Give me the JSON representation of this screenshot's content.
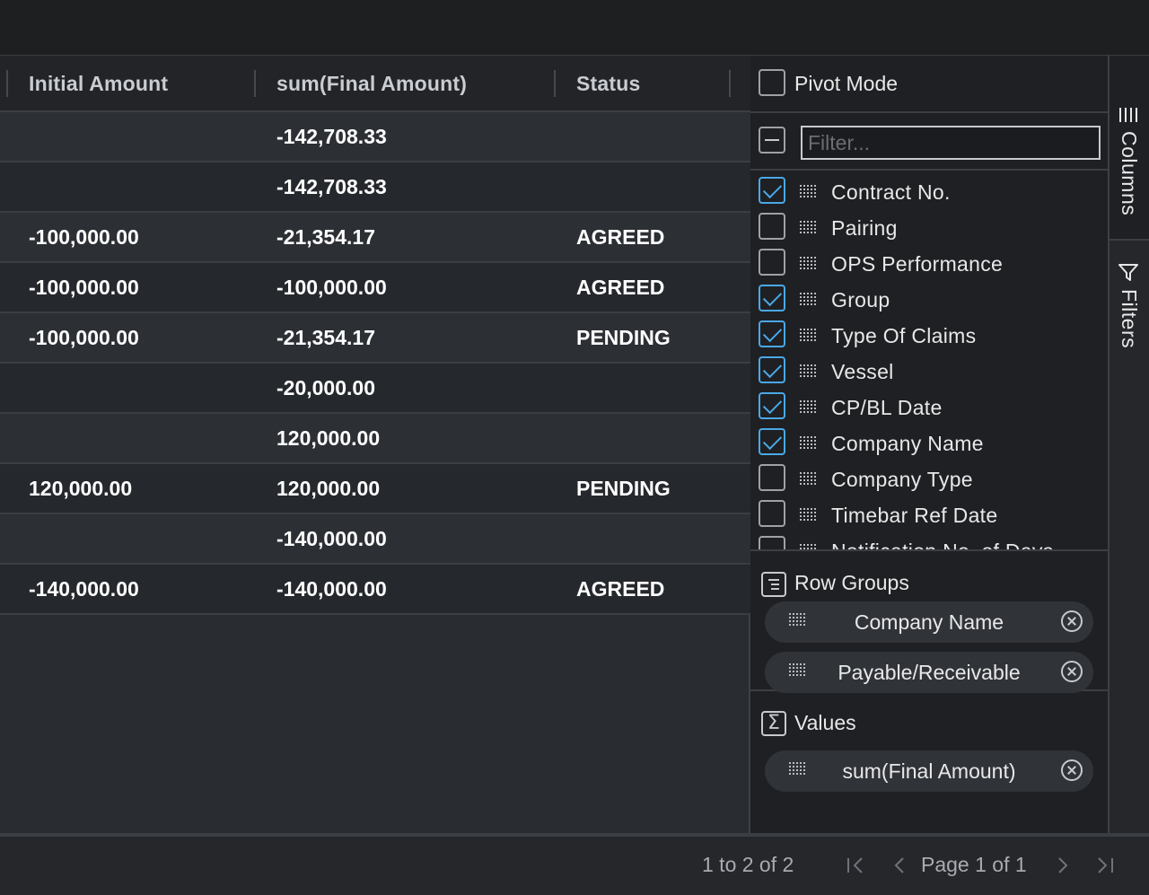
{
  "grid": {
    "columns": [
      "Initial Amount",
      "sum(Final Amount)",
      "Status"
    ],
    "rows": [
      [
        "",
        "-142,708.33",
        ""
      ],
      [
        "",
        "-142,708.33",
        ""
      ],
      [
        "-100,000.00",
        "-21,354.17",
        "AGREED"
      ],
      [
        "-100,000.00",
        "-100,000.00",
        "AGREED"
      ],
      [
        "-100,000.00",
        "-21,354.17",
        "PENDING"
      ],
      [
        "",
        "-20,000.00",
        ""
      ],
      [
        "",
        "120,000.00",
        ""
      ],
      [
        "120,000.00",
        "120,000.00",
        "PENDING"
      ],
      [
        "",
        "-140,000.00",
        ""
      ],
      [
        "-140,000.00",
        "-140,000.00",
        "AGREED"
      ]
    ]
  },
  "panel": {
    "pivot_mode_label": "Pivot Mode",
    "filter_placeholder": "Filter...",
    "columns": [
      {
        "label": "Contract No.",
        "checked": true
      },
      {
        "label": "Pairing",
        "checked": false
      },
      {
        "label": "OPS Performance",
        "checked": false
      },
      {
        "label": "Group",
        "checked": true
      },
      {
        "label": "Type Of Claims",
        "checked": true
      },
      {
        "label": "Vessel",
        "checked": true
      },
      {
        "label": "CP/BL Date",
        "checked": true
      },
      {
        "label": "Company Name",
        "checked": true
      },
      {
        "label": "Company Type",
        "checked": false
      },
      {
        "label": "Timebar Ref Date",
        "checked": false
      },
      {
        "label": "Notification No. of Days",
        "checked": false
      }
    ],
    "row_groups": {
      "title": "Row Groups",
      "items": [
        "Company Name",
        "Payable/Receivable"
      ]
    },
    "values": {
      "title": "Values",
      "items": [
        "sum(Final Amount)"
      ]
    }
  },
  "sidebar": {
    "tabs": [
      "Columns",
      "Filters"
    ]
  },
  "footer": {
    "summary": "1 to 2 of 2",
    "page_text": "Page 1 of 1",
    "first_icon": "first-page-icon",
    "prev_icon": "previous-page-icon",
    "next_icon": "next-page-icon",
    "last_icon": "last-page-icon"
  },
  "colors": {
    "accent": "#4aa8e8",
    "background": "#1f2022",
    "row_odd": "#2c2f34",
    "row_even": "#25282c"
  }
}
